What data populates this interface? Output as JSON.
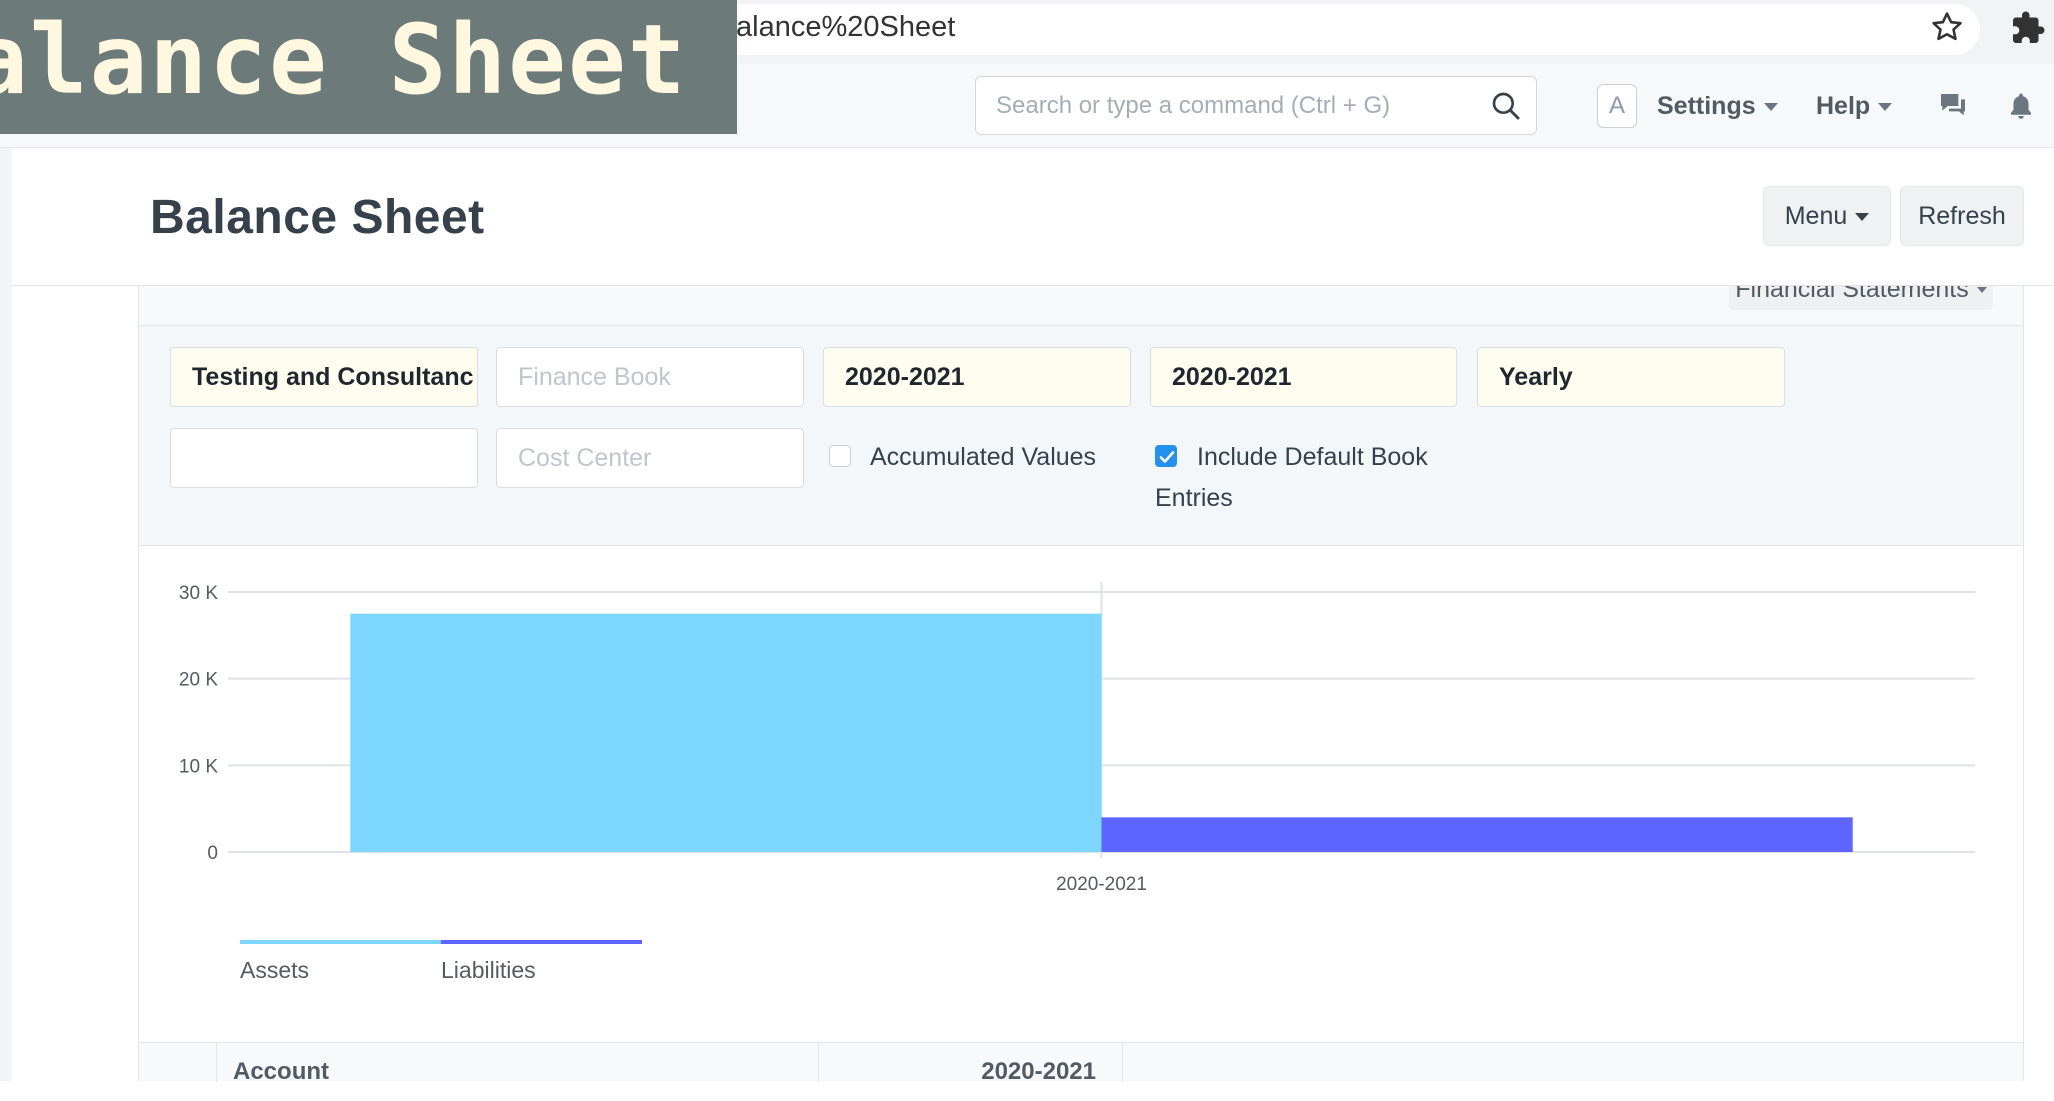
{
  "browser": {
    "url_fragment": "alance%20Sheet"
  },
  "overlay_label": "alance Sheet",
  "navbar": {
    "search_placeholder": "Search or type a command (Ctrl + G)",
    "avatar_initial": "A",
    "settings_label": "Settings",
    "help_label": "Help"
  },
  "page": {
    "title": "Balance Sheet",
    "menu_label": "Menu",
    "refresh_label": "Refresh",
    "financial_statements_label": "Financial Statements"
  },
  "filters": {
    "company": "Testing and Consultanc",
    "finance_book_placeholder": "Finance Book",
    "from_fiscal_year": "2020-2021",
    "to_fiscal_year": "2020-2021",
    "periodicity": "Yearly",
    "presentation_currency": "",
    "cost_center_placeholder": "Cost Center",
    "accumulated_values_label": "Accumulated Values",
    "accumulated_values_checked": false,
    "include_default_book_label": "Include Default Book",
    "include_default_book_label_line2": "Entries",
    "include_default_book_checked": true
  },
  "chart_data": {
    "type": "bar",
    "title": "",
    "xlabel": "",
    "ylabel": "",
    "categories": [
      "2020-2021"
    ],
    "series": [
      {
        "name": "Assets",
        "values": [
          27500
        ],
        "color": "#7cd6fd"
      },
      {
        "name": "Liabilities",
        "values": [
          4000
        ],
        "color": "#5e64ff"
      }
    ],
    "ylim": [
      0,
      30000
    ],
    "yticks": [
      0,
      10000,
      20000,
      30000
    ],
    "ytick_labels": [
      "0",
      "10 K",
      "20 K",
      "30 K"
    ],
    "grid": true,
    "legend_position": "bottom-left"
  },
  "table": {
    "col_account": "Account",
    "col_period": "2020-2021"
  }
}
